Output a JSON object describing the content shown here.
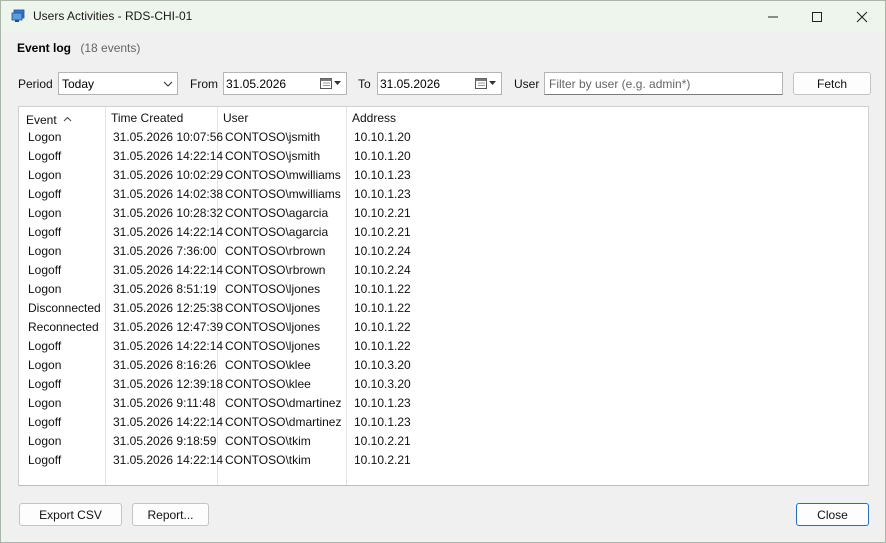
{
  "window": {
    "title": "Users Activities - RDS-CHI-01",
    "accent": "#2a6fb6"
  },
  "header": {
    "label": "Event log",
    "count": "(18 events)"
  },
  "filters": {
    "period_label": "Period",
    "period_value": "Today",
    "from_label": "From",
    "from_value": "31.05.2026",
    "to_label": "To",
    "to_value": "31.05.2026",
    "user_label": "User",
    "user_value": "",
    "user_placeholder": "Filter by user (e.g. admin*)",
    "fetch_label": "Fetch"
  },
  "table": {
    "columns": [
      "Event",
      "Time Created",
      "User",
      "Address"
    ],
    "sort_column": "Event",
    "sort_direction": "ascending",
    "rows": [
      [
        "Logon",
        "31.05.2026 10:07:56",
        "CONTOSO\\jsmith",
        "10.10.1.20"
      ],
      [
        "Logoff",
        "31.05.2026 14:22:14",
        "CONTOSO\\jsmith",
        "10.10.1.20"
      ],
      [
        "Logon",
        "31.05.2026 10:02:29",
        "CONTOSO\\mwilliams",
        "10.10.1.23"
      ],
      [
        "Logoff",
        "31.05.2026 14:02:38",
        "CONTOSO\\mwilliams",
        "10.10.1.23"
      ],
      [
        "Logon",
        "31.05.2026 10:28:32",
        "CONTOSO\\agarcia",
        "10.10.2.21"
      ],
      [
        "Logoff",
        "31.05.2026 14:22:14",
        "CONTOSO\\agarcia",
        "10.10.2.21"
      ],
      [
        "Logon",
        "31.05.2026 7:36:00",
        "CONTOSO\\rbrown",
        "10.10.2.24"
      ],
      [
        "Logoff",
        "31.05.2026 14:22:14",
        "CONTOSO\\rbrown",
        "10.10.2.24"
      ],
      [
        "Logon",
        "31.05.2026 8:51:19",
        "CONTOSO\\ljones",
        "10.10.1.22"
      ],
      [
        "Disconnected",
        "31.05.2026 12:25:38",
        "CONTOSO\\ljones",
        "10.10.1.22"
      ],
      [
        "Reconnected",
        "31.05.2026 12:47:39",
        "CONTOSO\\ljones",
        "10.10.1.22"
      ],
      [
        "Logoff",
        "31.05.2026 14:22:14",
        "CONTOSO\\ljones",
        "10.10.1.22"
      ],
      [
        "Logon",
        "31.05.2026 8:16:26",
        "CONTOSO\\klee",
        "10.10.3.20"
      ],
      [
        "Logoff",
        "31.05.2026 12:39:18",
        "CONTOSO\\klee",
        "10.10.3.20"
      ],
      [
        "Logon",
        "31.05.2026 9:11:48",
        "CONTOSO\\dmartinez",
        "10.10.1.23"
      ],
      [
        "Logoff",
        "31.05.2026 14:22:14",
        "CONTOSO\\dmartinez",
        "10.10.1.23"
      ],
      [
        "Logon",
        "31.05.2026 9:18:59",
        "CONTOSO\\tkim",
        "10.10.2.21"
      ],
      [
        "Logoff",
        "31.05.2026 14:22:14",
        "CONTOSO\\tkim",
        "10.10.2.21"
      ]
    ]
  },
  "footer": {
    "export_label": "Export CSV",
    "report_label": "Report...",
    "close_label": "Close"
  }
}
